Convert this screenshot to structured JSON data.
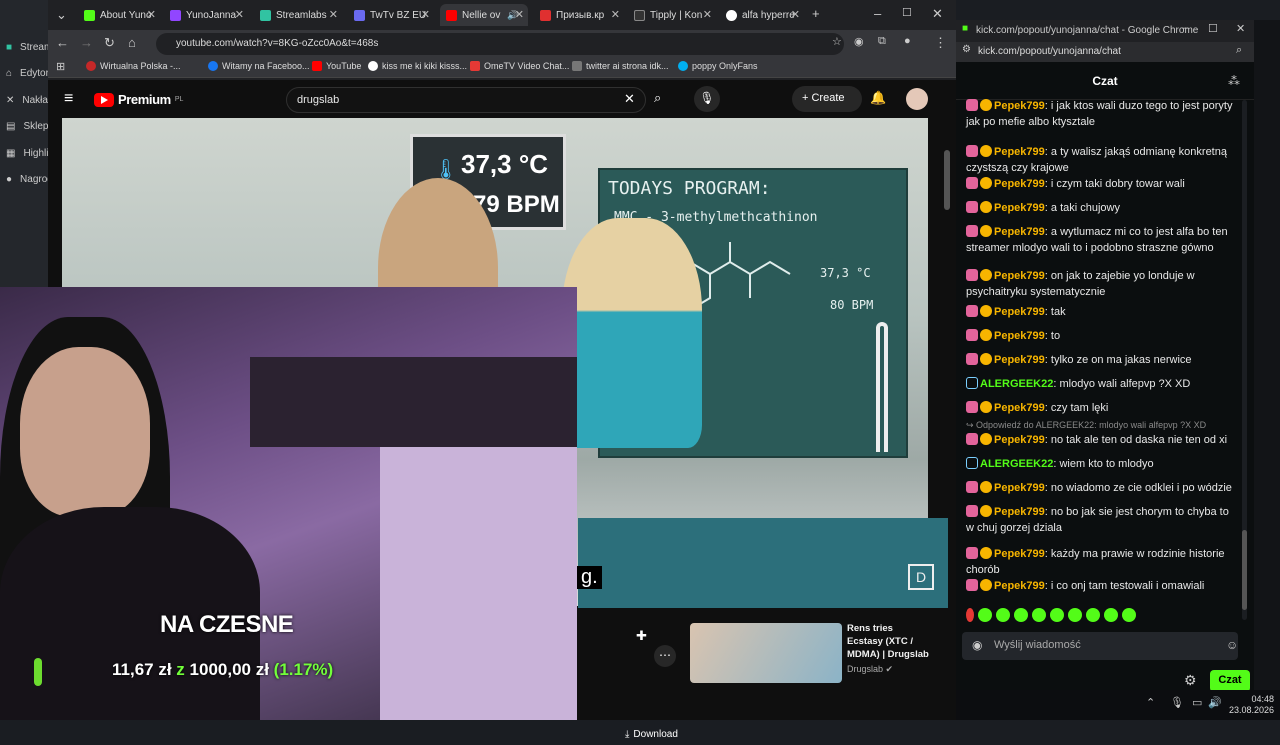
{
  "left_app": {
    "items": [
      "Streamlabs",
      "Edytor",
      "Nakładki",
      "Sklep",
      "Highlights",
      "Nagrody"
    ]
  },
  "browser": {
    "tabs": [
      {
        "label": "About Yuno",
        "color": "#53fc18"
      },
      {
        "label": "YunoJanna",
        "color": "#9146ff"
      },
      {
        "label": "Streamlabs",
        "color": "#31c3a2"
      },
      {
        "label": "TwTv BZ EU",
        "color": "#6a6af0"
      },
      {
        "label": "Nellie ov",
        "color": "#ff0000"
      },
      {
        "label": "Призыв.кр",
        "color": "#e03030"
      },
      {
        "label": "Tipply | Kon",
        "color": "#333333"
      },
      {
        "label": "alfa hyperre",
        "color": "#ffffff"
      }
    ],
    "url": "youtube.com/watch?v=8KG-oZcc0Ao&t=468s",
    "bookmarks": [
      "Wirtualna Polska -...",
      "Witamy na Faceboo...",
      "YouTube",
      "kiss me ki kiki kisss...",
      "OmeTV Video Chat...",
      "twitter ai strona idk...",
      "poppy OnlyFans"
    ]
  },
  "youtube": {
    "brand": "Premium",
    "brand_region": "PL",
    "search_value": "drugslab",
    "create_label": "Create",
    "video_overlay": {
      "temp": "37,3 °C",
      "bpm": "79 BPM",
      "board_title": "TODAYS PROGRAM:",
      "board_formula": "MMC - 3-methylmethcathinon",
      "board_temp": "37,3 °C",
      "board_bpm": "80 BPM",
      "caption": "g.",
      "watermark": "D"
    },
    "download_label": "Download",
    "recommended": {
      "title": "Rens tries Ecstasy (XTC / MDMA) | Drugslab",
      "channel": "Drugslab"
    }
  },
  "stream_overlay": {
    "goal_title": "NA CZESNE",
    "goal_current": "11,67 zł",
    "goal_sep": "z",
    "goal_target": "1000,00 zł",
    "goal_percent": "(1.17%)"
  },
  "kick": {
    "window_title": "kick.com/popout/yunojanna/chat - Google Chrome",
    "url": "kick.com/popout/yunojanna/chat",
    "header": "Czat",
    "messages": [
      {
        "user": "Pepek799",
        "text": "i jak ktos wali duzo tego to jest poryty jak po mefie albo ktysztale",
        "color": "#f7b500"
      },
      {
        "user": "Pepek799",
        "text": "a ty walisz jakąś odmianę konkretną czystszą czy krajowe",
        "color": "#f7b500"
      },
      {
        "user": "Pepek799",
        "text": "i czym taki dobry towar wali",
        "color": "#f7b500"
      },
      {
        "user": "Pepek799",
        "text": "a taki chujowy",
        "color": "#f7b500"
      },
      {
        "user": "Pepek799",
        "text": "a wytlumacz mi co to jest alfa bo ten streamer mlodyo wali to i podobno straszne gówno",
        "color": "#f7b500"
      },
      {
        "user": "Pepek799",
        "text": "on jak to zajebie yo londuje w psychaitryku systematycznie",
        "color": "#f7b500"
      },
      {
        "user": "Pepek799",
        "text": "tak",
        "color": "#f7b500"
      },
      {
        "user": "Pepek799",
        "text": "to",
        "color": "#f7b500"
      },
      {
        "user": "Pepek799",
        "text": "tylko ze on ma jakas nerwice",
        "color": "#f7b500"
      },
      {
        "user": "ALERGEEK22",
        "text": "mlodyo wali alfepvp ?X XD",
        "color": "#53fc18"
      },
      {
        "user": "Pepek799",
        "text": "czy tam lęki",
        "color": "#f7b500"
      },
      {
        "user": "Pepek799",
        "text": "no tak ale ten od daska nie ten od xi",
        "color": "#f7b500"
      },
      {
        "user": "ALERGEEK22",
        "text": "wiem kto to mlodyo",
        "color": "#53fc18"
      },
      {
        "user": "Pepek799",
        "text": "no wiadomo ze cie odklei i po wódzie",
        "color": "#f7b500"
      },
      {
        "user": "Pepek799",
        "text": "no bo jak sie jest chorym to chyba to w chuj gorzej dziala",
        "color": "#f7b500"
      },
      {
        "user": "Pepek799",
        "text": "każdy ma prawie w rodzinie historie chorób",
        "color": "#f7b500"
      },
      {
        "user": "Pepek799",
        "text": "i co onj tam testowali i omawiali",
        "color": "#f7b500"
      }
    ],
    "reply_note": "Odpowiedź do ALERGEEK22: mlodyo wali alfepvp ?X XD",
    "input_placeholder": "Wyślij wiadomość",
    "send_label": "Czat"
  },
  "taskbar": {
    "time": "04:48",
    "date": "23.08.2026"
  }
}
